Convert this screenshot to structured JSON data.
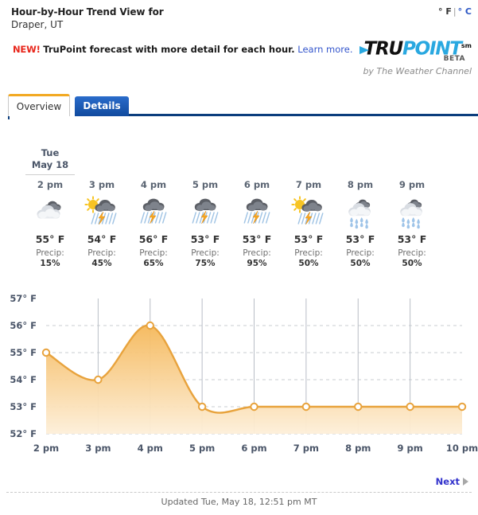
{
  "header": {
    "title": "Hour-by-Hour Trend View for",
    "location": "Draper, UT",
    "unit_fahrenheit": "° F",
    "unit_separator": "|",
    "unit_celsius": "° C"
  },
  "promo": {
    "badge": "NEW!",
    "text": "TruPoint forecast with more detail for each hour.",
    "link": "Learn more."
  },
  "logo": {
    "word_tru": "TRU",
    "word_point": "POINT",
    "service_mark": "sm",
    "beta": "BETA",
    "byline": "by The Weather Channel",
    "accent_color": "#29a8e0"
  },
  "tabs": [
    {
      "label": "Overview",
      "active": true
    },
    {
      "label": "Details",
      "active": false
    }
  ],
  "forecast": {
    "day_name": "Tue",
    "day_date": "May 18",
    "precip_label": "Precip:",
    "hours": [
      {
        "time": "2 pm",
        "temp": "55° F",
        "precip": "15%",
        "icon": "cloudy-icon"
      },
      {
        "time": "3 pm",
        "temp": "54° F",
        "precip": "45%",
        "icon": "sun-thunderstorm-icon"
      },
      {
        "time": "4 pm",
        "temp": "56° F",
        "precip": "65%",
        "icon": "thunderstorm-icon"
      },
      {
        "time": "5 pm",
        "temp": "53° F",
        "precip": "75%",
        "icon": "thunderstorm-icon"
      },
      {
        "time": "6 pm",
        "temp": "53° F",
        "precip": "95%",
        "icon": "thunderstorm-icon"
      },
      {
        "time": "7 pm",
        "temp": "53° F",
        "precip": "50%",
        "icon": "sun-thunderstorm-icon"
      },
      {
        "time": "8 pm",
        "temp": "53° F",
        "precip": "50%",
        "icon": "rain-showers-icon"
      },
      {
        "time": "9 pm",
        "temp": "53° F",
        "precip": "50%",
        "icon": "rain-showers-icon"
      }
    ]
  },
  "chart_data": {
    "type": "area",
    "title": "",
    "xlabel": "",
    "ylabel": "",
    "x": [
      "2 pm",
      "3 pm",
      "4 pm",
      "5 pm",
      "6 pm",
      "7 pm",
      "8 pm",
      "9 pm",
      "10 pm"
    ],
    "values": [
      55,
      54,
      56,
      53,
      53,
      53,
      53,
      53,
      53
    ],
    "ytick_labels": [
      "57° F",
      "56° F",
      "55° F",
      "54° F",
      "53° F",
      "52° F"
    ],
    "yticks": [
      57,
      56,
      55,
      54,
      53,
      52
    ],
    "ylim": [
      52,
      57
    ],
    "grid": "horizontal-dashed-and-vertical-solid",
    "legend": "none",
    "line_color": "#e8a33d",
    "fill_color_top": "#f5b85a",
    "fill_color_bottom": "#fdefd9",
    "marker_fill": "#ffffff"
  },
  "footer": {
    "next_label": "Next",
    "updated": "Updated Tue, May 18, 12:51 pm MT"
  }
}
